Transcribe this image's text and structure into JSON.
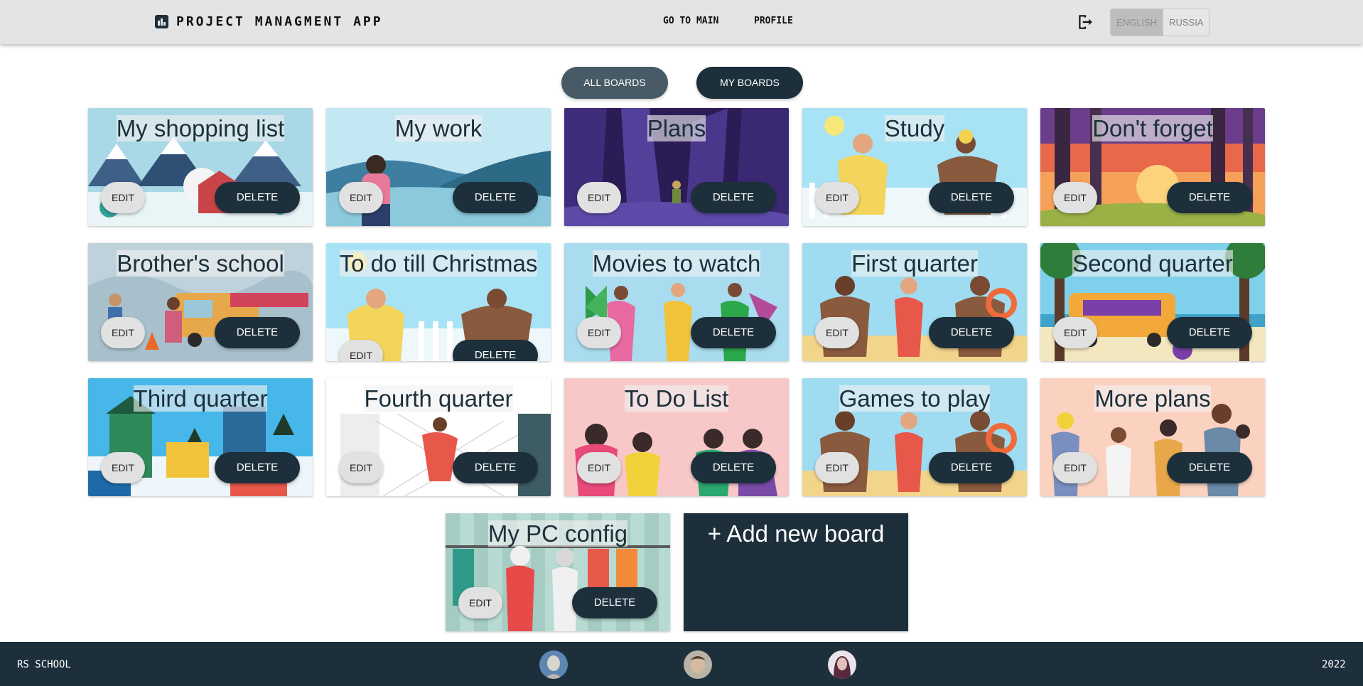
{
  "header": {
    "app_title": "PROJECT MANAGMENT APP",
    "nav_main": "GO TO MAIN",
    "nav_profile": "PROFILE",
    "logout_icon": "logout-icon",
    "lang_active": "ENGLISH",
    "lang_other": "RUSSIA"
  },
  "filters": {
    "all_boards": "ALL BOARDS",
    "my_boards": "MY BOARDS",
    "selected": "ALL BOARDS"
  },
  "buttons": {
    "edit": "EDIT",
    "delete": "DELETE"
  },
  "boards": [
    {
      "title": "My shopping list"
    },
    {
      "title": "My work"
    },
    {
      "title": "Plans"
    },
    {
      "title": "Study"
    },
    {
      "title": "Don't forget"
    },
    {
      "title": "Brother's school"
    },
    {
      "title": "To do till Christmas"
    },
    {
      "title": "Movies to watch"
    },
    {
      "title": "First quarter"
    },
    {
      "title": "Second quarter"
    },
    {
      "title": "Third quarter"
    },
    {
      "title": "Fourth quarter"
    },
    {
      "title": "To Do List"
    },
    {
      "title": "Games to play"
    },
    {
      "title": "More plans"
    },
    {
      "title": "My PC config"
    }
  ],
  "add_board_label": "+ Add new board",
  "footer": {
    "school": "RS SCHOOL",
    "year": "2022"
  },
  "colors": {
    "primary": "#1c2f3b",
    "header_bg": "#e4e4e4",
    "pill_selected": "#475a65"
  }
}
